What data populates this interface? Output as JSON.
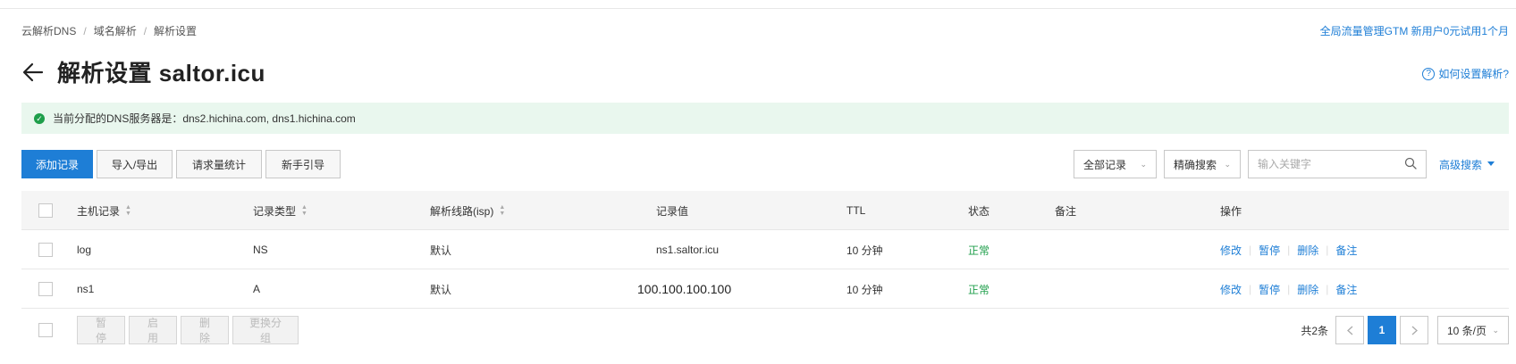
{
  "breadcrumb": [
    "云解析DNS",
    "域名解析",
    "解析设置"
  ],
  "promo": "全局流量管理GTM 新用户0元试用1个月",
  "title": "解析设置 saltor.icu",
  "help": "如何设置解析?",
  "notice": "当前分配的DNS服务器是：dns2.hichina.com, dns1.hichina.com",
  "toolbar": {
    "add": "添加记录",
    "import_export": "导入/导出",
    "stats": "请求量统计",
    "guide": "新手引导"
  },
  "filters": {
    "all_records": "全部记录",
    "exact_search": "精确搜索",
    "search_placeholder": "输入关键字",
    "advanced": "高级搜索"
  },
  "columns": [
    "主机记录",
    "记录类型",
    "解析线路(isp)",
    "记录值",
    "TTL",
    "状态",
    "备注",
    "操作"
  ],
  "rows": [
    {
      "host": "log",
      "type": "NS",
      "line": "默认",
      "value": "ns1.saltor.icu",
      "ttl": "10 分钟",
      "status": "正常",
      "remark": ""
    },
    {
      "host": "ns1",
      "type": "A",
      "line": "默认",
      "value": "100.100.100.100",
      "ttl": "10 分钟",
      "status": "正常",
      "remark": ""
    }
  ],
  "ops": [
    "修改",
    "暂停",
    "删除",
    "备注"
  ],
  "bulk": [
    "暂 停",
    "启 用",
    "删 除",
    "更换分组"
  ],
  "pager": {
    "total": "共2条",
    "current": "1",
    "page_size": "10 条/页"
  },
  "colors": {
    "accent": "#1e7ed6",
    "success": "#1e9e4a",
    "notice_bg": "#e9f7ee"
  }
}
